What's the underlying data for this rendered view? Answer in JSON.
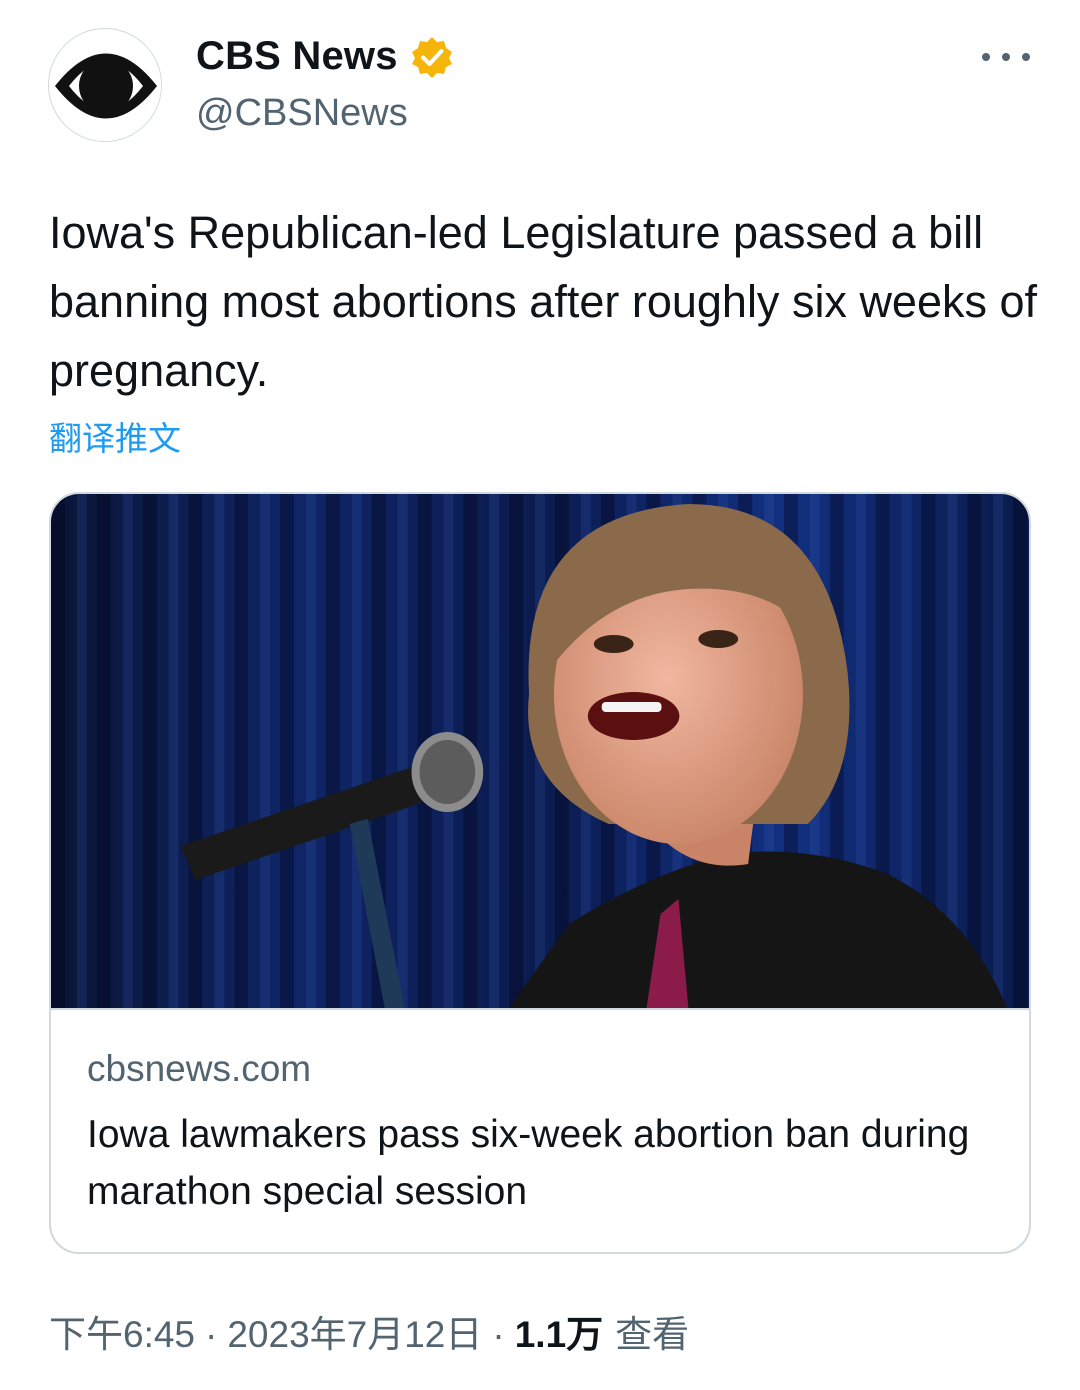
{
  "author": {
    "display_name": "CBS News",
    "handle": "@CBSNews",
    "avatar_icon": "cbs-eye-logo-icon",
    "verified_icon": "verified-badge-icon",
    "verified_color": "#f5b50a"
  },
  "tweet": {
    "text": "Iowa's Republican-led Legislature passed a bill banning most abortions after roughly six weeks of pregnancy.",
    "translate_label": "翻译推文"
  },
  "card": {
    "image_icon": "news-photo-speaker-at-microphone",
    "domain": "cbsnews.com",
    "title": "Iowa lawmakers pass six-week abortion ban during marathon special session"
  },
  "meta": {
    "time": "下午6:45",
    "date": "2023年7月12日",
    "separator": "·",
    "views_count": "1.1万",
    "views_label": "查看"
  },
  "colors": {
    "link": "#1d9bf0",
    "secondary_text": "#536471",
    "primary_text": "#0f1419",
    "border": "#cfd9de"
  }
}
